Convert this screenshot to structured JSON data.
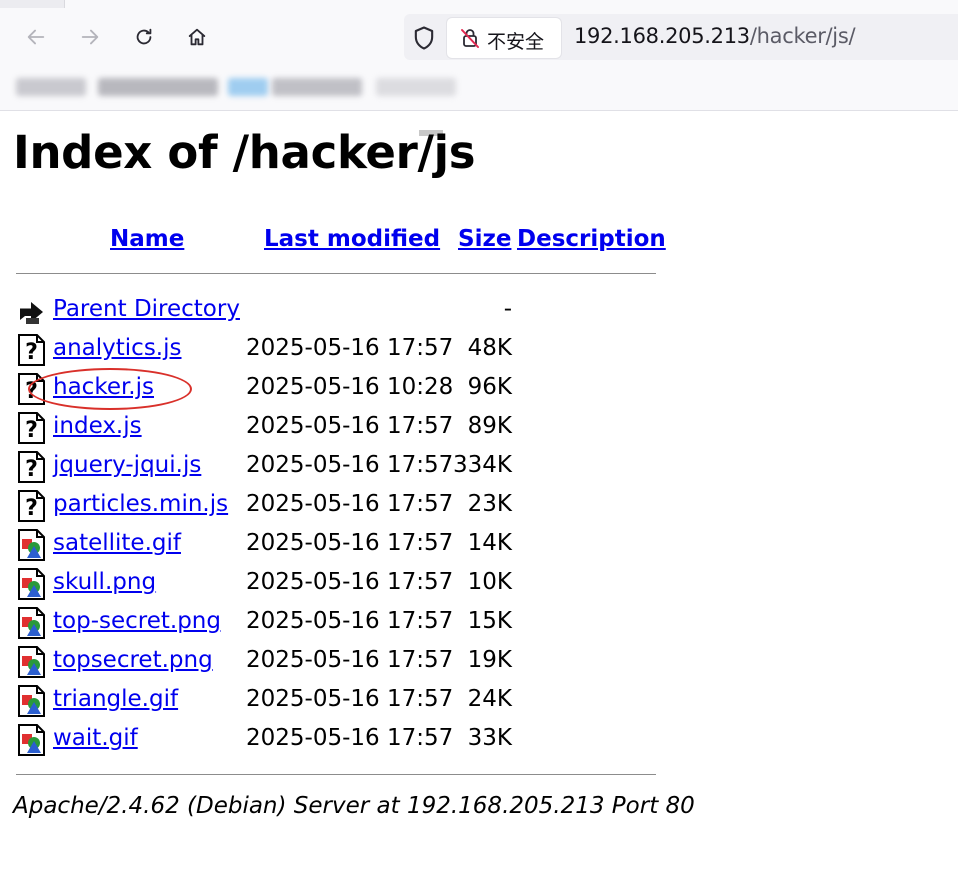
{
  "browser": {
    "security_label": "不安全",
    "url_host": "192.168.205.213",
    "url_path": "/hacker/js/"
  },
  "page": {
    "title": "Index of /hacker/js",
    "columns": {
      "name": "Name",
      "last_modified": "Last modified",
      "size": "Size",
      "description": "Description"
    },
    "entries": [
      {
        "name": "Parent Directory",
        "date": "",
        "size": "-",
        "icon": "back-folder-icon"
      },
      {
        "name": "analytics.js",
        "date": "2025-05-16 17:57",
        "size": "48K",
        "icon": "unknown-file-icon"
      },
      {
        "name": "hacker.js",
        "date": "2025-05-16 10:28",
        "size": "96K",
        "icon": "unknown-file-icon"
      },
      {
        "name": "index.js",
        "date": "2025-05-16 17:57",
        "size": "89K",
        "icon": "unknown-file-icon"
      },
      {
        "name": "jquery-jqui.js",
        "date": "2025-05-16 17:57",
        "size": "334K",
        "icon": "unknown-file-icon"
      },
      {
        "name": "particles.min.js",
        "date": "2025-05-16 17:57",
        "size": "23K",
        "icon": "unknown-file-icon"
      },
      {
        "name": "satellite.gif",
        "date": "2025-05-16 17:57",
        "size": "14K",
        "icon": "image-file-icon"
      },
      {
        "name": "skull.png",
        "date": "2025-05-16 17:57",
        "size": "10K",
        "icon": "image-file-icon"
      },
      {
        "name": "top-secret.png",
        "date": "2025-05-16 17:57",
        "size": "15K",
        "icon": "image-file-icon"
      },
      {
        "name": "topsecret.png",
        "date": "2025-05-16 17:57",
        "size": "19K",
        "icon": "image-file-icon"
      },
      {
        "name": "triangle.gif",
        "date": "2025-05-16 17:57",
        "size": "24K",
        "icon": "image-file-icon"
      },
      {
        "name": "wait.gif",
        "date": "2025-05-16 17:57",
        "size": "33K",
        "icon": "image-file-icon"
      }
    ],
    "footer": "Apache/2.4.62 (Debian) Server at 192.168.205.213 Port 80",
    "link_color": "#0000ee",
    "annotation_color": "#d9302a"
  }
}
